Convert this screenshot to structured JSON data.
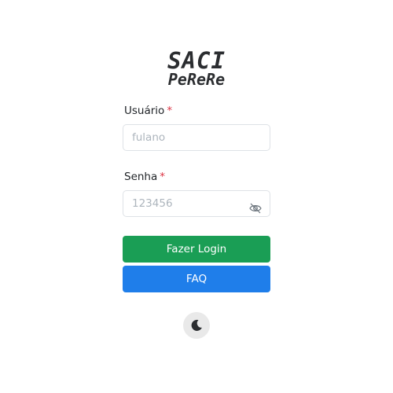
{
  "logo": {
    "line1": "SACI",
    "line2": "PeReRe"
  },
  "form": {
    "username": {
      "label": "Usuário",
      "required_mark": "*",
      "placeholder": "fulano"
    },
    "password": {
      "label": "Senha",
      "required_mark": "*",
      "placeholder": "123456",
      "toggle_icon": "eye-slash-icon"
    }
  },
  "buttons": {
    "login_label": "Fazer Login",
    "faq_label": "FAQ"
  },
  "theme_toggle": {
    "icon": "moon-icon"
  },
  "colors": {
    "login": "#1a9e55",
    "faq": "#1f7eea",
    "required": "#dc3545"
  }
}
